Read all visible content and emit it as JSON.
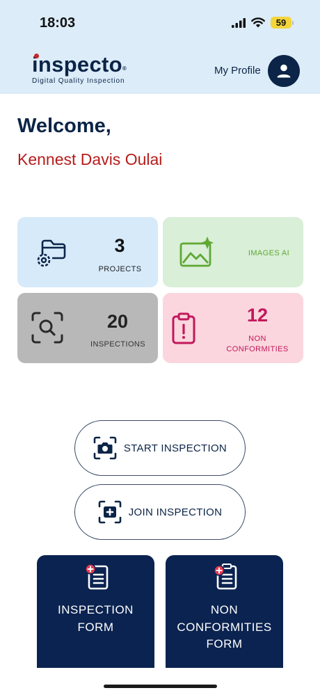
{
  "status_bar": {
    "time": "18:03",
    "battery": "59"
  },
  "header": {
    "logo_text": "inspecto",
    "logo_reg": "®",
    "logo_tagline": "Digital Quality Inspection",
    "profile_label": "My Profile"
  },
  "greeting": {
    "welcome": "Welcome,",
    "user_name": "Kennest Davis Oulai"
  },
  "stats": {
    "projects": {
      "count": "3",
      "label": "PROJECTS"
    },
    "images_ai": {
      "label": "IMAGES AI"
    },
    "inspections": {
      "count": "20",
      "label": "INSPECTIONS"
    },
    "non_conformities": {
      "count": "12",
      "label_line1": "NON",
      "label_line2": "CONFORMITIES"
    }
  },
  "actions": {
    "start_label": "START INSPECTION",
    "join_label": "JOIN INSPECTION"
  },
  "forms": {
    "inspection_line1": "INSPECTION",
    "inspection_line2": "FORM",
    "nc_line1": "NON",
    "nc_line2": "CONFORMITIES",
    "nc_line3": "FORM"
  },
  "colors": {
    "brand_navy": "#0b2447",
    "accent_red": "#b71c1c",
    "header_bg": "#dcecf8",
    "projects_bg": "#d6eafa",
    "images_bg": "#d9efd8",
    "inspections_bg": "#b8b8b8",
    "nc_bg": "#fbd6de"
  },
  "icons": {
    "projects": "folder-gear-icon",
    "images_ai": "image-sparkle-icon",
    "inspections": "scan-search-icon",
    "non_conformities": "clipboard-alert-icon",
    "start_inspection": "camera-scan-icon",
    "join_inspection": "add-scan-icon",
    "form": "clipboard-plus-icon",
    "profile": "user-icon"
  }
}
